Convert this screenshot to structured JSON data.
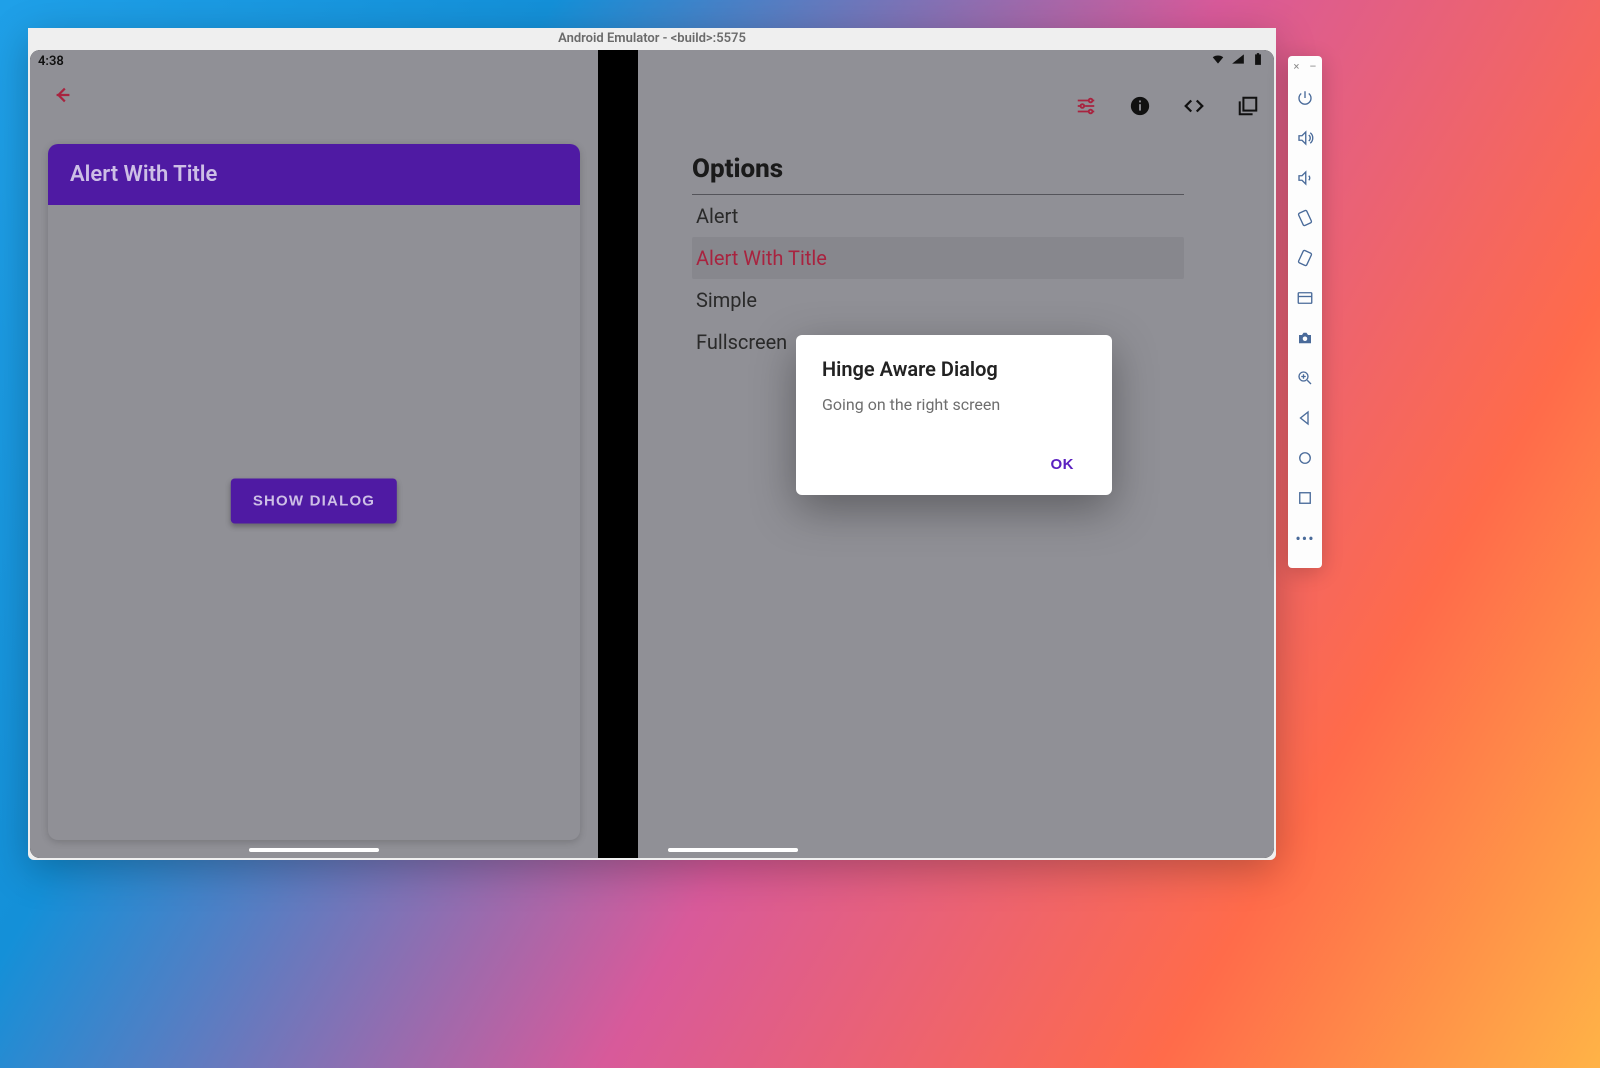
{
  "emulator": {
    "title": "Android Emulator - <build>:5575"
  },
  "status": {
    "clock": "4:38"
  },
  "left": {
    "card_title": "Alert With Title",
    "button": "SHOW DIALOG"
  },
  "right": {
    "options_title": "Options",
    "options": [
      {
        "label": "Alert",
        "selected": false
      },
      {
        "label": "Alert With Title",
        "selected": true
      },
      {
        "label": "Simple",
        "selected": false
      },
      {
        "label": "Fullscreen",
        "selected": false
      }
    ]
  },
  "dialog": {
    "title": "Hinge Aware Dialog",
    "body": "Going on the right screen",
    "ok": "OK"
  },
  "toolbar": {
    "close": "×",
    "min": "–"
  },
  "colors": {
    "purple": "#4f1aa3",
    "accent_red": "#a8233f",
    "ok_purple": "#5a20c0"
  }
}
